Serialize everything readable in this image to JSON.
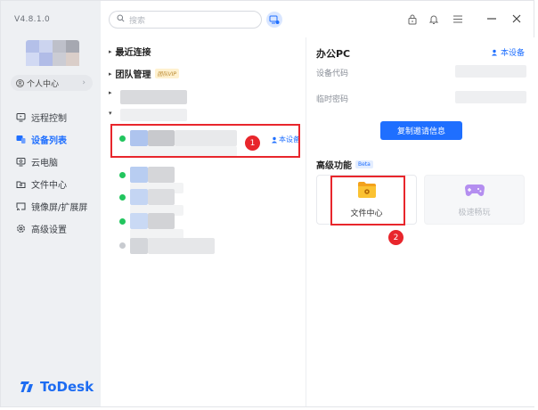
{
  "app": {
    "version": "V4.8.1.0",
    "logo_text": "ToDesk",
    "brand_color": "#1f6fff",
    "annotation_color": "#e8262c"
  },
  "sidebar": {
    "personal_center": "个人中心",
    "items": [
      {
        "label": "远程控制",
        "icon": "monitor-remote-icon",
        "active": false
      },
      {
        "label": "设备列表",
        "icon": "devices-icon",
        "active": true
      },
      {
        "label": "云电脑",
        "icon": "cloud-pc-icon",
        "active": false
      },
      {
        "label": "文件中心",
        "icon": "folder-icon",
        "active": false
      },
      {
        "label": "镜像屏/扩展屏",
        "icon": "screen-cast-icon",
        "active": false
      },
      {
        "label": "高级设置",
        "icon": "gear-icon",
        "active": false
      }
    ]
  },
  "topbar": {
    "search_placeholder": "搜索"
  },
  "device_list": {
    "recent": "最近连接",
    "team": "团队管理",
    "team_badge": "团队VIP",
    "this_device": "本设备",
    "badge1": "1"
  },
  "detail": {
    "title": "办公PC",
    "this_device": "本设备",
    "device_code_label": "设备代码",
    "temp_password_label": "临时密码",
    "copy_button": "复制邀请信息",
    "advanced": "高级功能",
    "beta": "Beta",
    "cards": [
      {
        "label": "文件中心",
        "icon": "folder-icon"
      },
      {
        "label": "极速畅玩",
        "icon": "gamepad-icon"
      }
    ],
    "badge2": "2"
  }
}
